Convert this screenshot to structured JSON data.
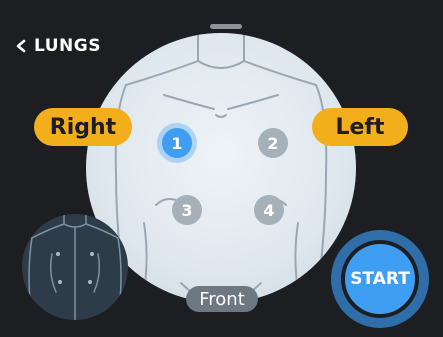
{
  "header": {
    "back_icon": "chevron-left-icon",
    "title": "LUNGS"
  },
  "body_view": {
    "left_side_label": "Right",
    "right_side_label": "Left",
    "view_label": "Front",
    "points": [
      {
        "label": "1",
        "active": true
      },
      {
        "label": "2",
        "active": false
      },
      {
        "label": "3",
        "active": false
      },
      {
        "label": "4",
        "active": false
      }
    ]
  },
  "actions": {
    "start_label": "START",
    "back_view_thumbnail": "back-view"
  },
  "colors": {
    "accent": "#3f9df2",
    "side_label": "#f3ae1c",
    "background": "#1d1e21"
  }
}
